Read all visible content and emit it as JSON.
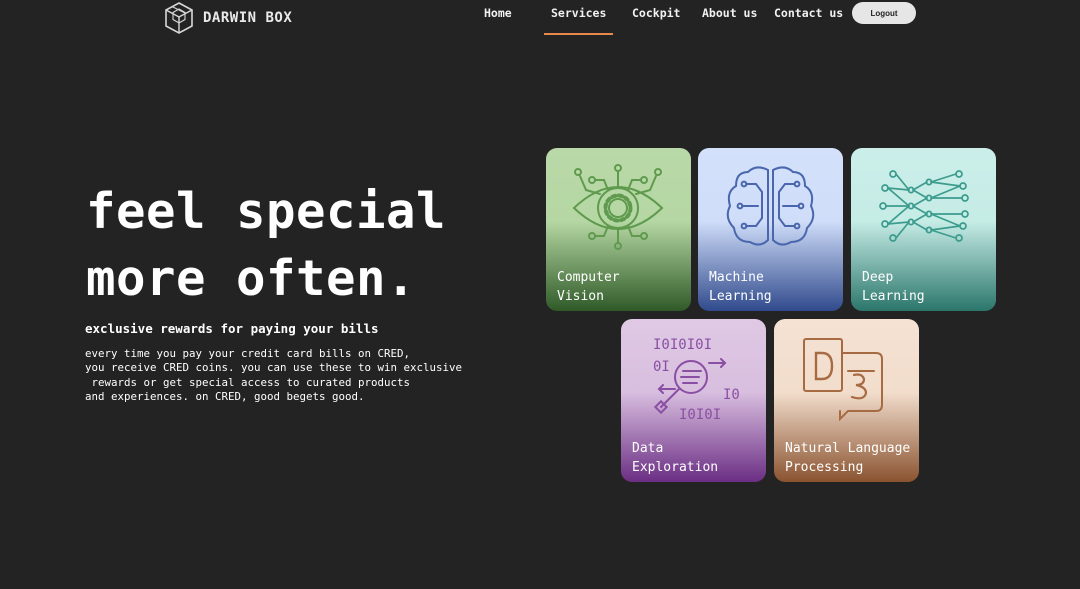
{
  "nav": {
    "brand": "DARWIN BOX",
    "links": [
      {
        "label": "Home"
      },
      {
        "label": "Services",
        "active": true
      },
      {
        "label": "Cockpit"
      },
      {
        "label": "About us"
      },
      {
        "label": "Contact us"
      }
    ],
    "logout_label": "Logout",
    "active_underline_color": "#e8894c"
  },
  "hero": {
    "title_line1": "feel special",
    "title_line2": "more often.",
    "subtitle": "exclusive rewards for paying your bills",
    "body": "every time you pay your credit card bills on CRED,\nyou receive CRED coins. you can use these to win exclusive\n rewards or get special access to curated products\nand experiences. on CRED, good begets good."
  },
  "cards": [
    {
      "label_line1": "Computer",
      "label_line2": "Vision",
      "icon": "eye-circuit-icon",
      "color": "#5f9a4e"
    },
    {
      "label_line1": "Machine",
      "label_line2": "Learning",
      "icon": "brain-circuit-icon",
      "color": "#4a67ad"
    },
    {
      "label_line1": "Deep",
      "label_line2": "Learning",
      "icon": "neural-network-icon",
      "color": "#3c9c8e"
    },
    {
      "label_line1": "Data",
      "label_line2": "Exploration",
      "icon": "binary-magnifier-icon",
      "color": "#8a4fa3"
    },
    {
      "label_line1": "Natural Language",
      "label_line2": "Processing",
      "icon": "translation-icon",
      "color": "#a66b43"
    }
  ]
}
